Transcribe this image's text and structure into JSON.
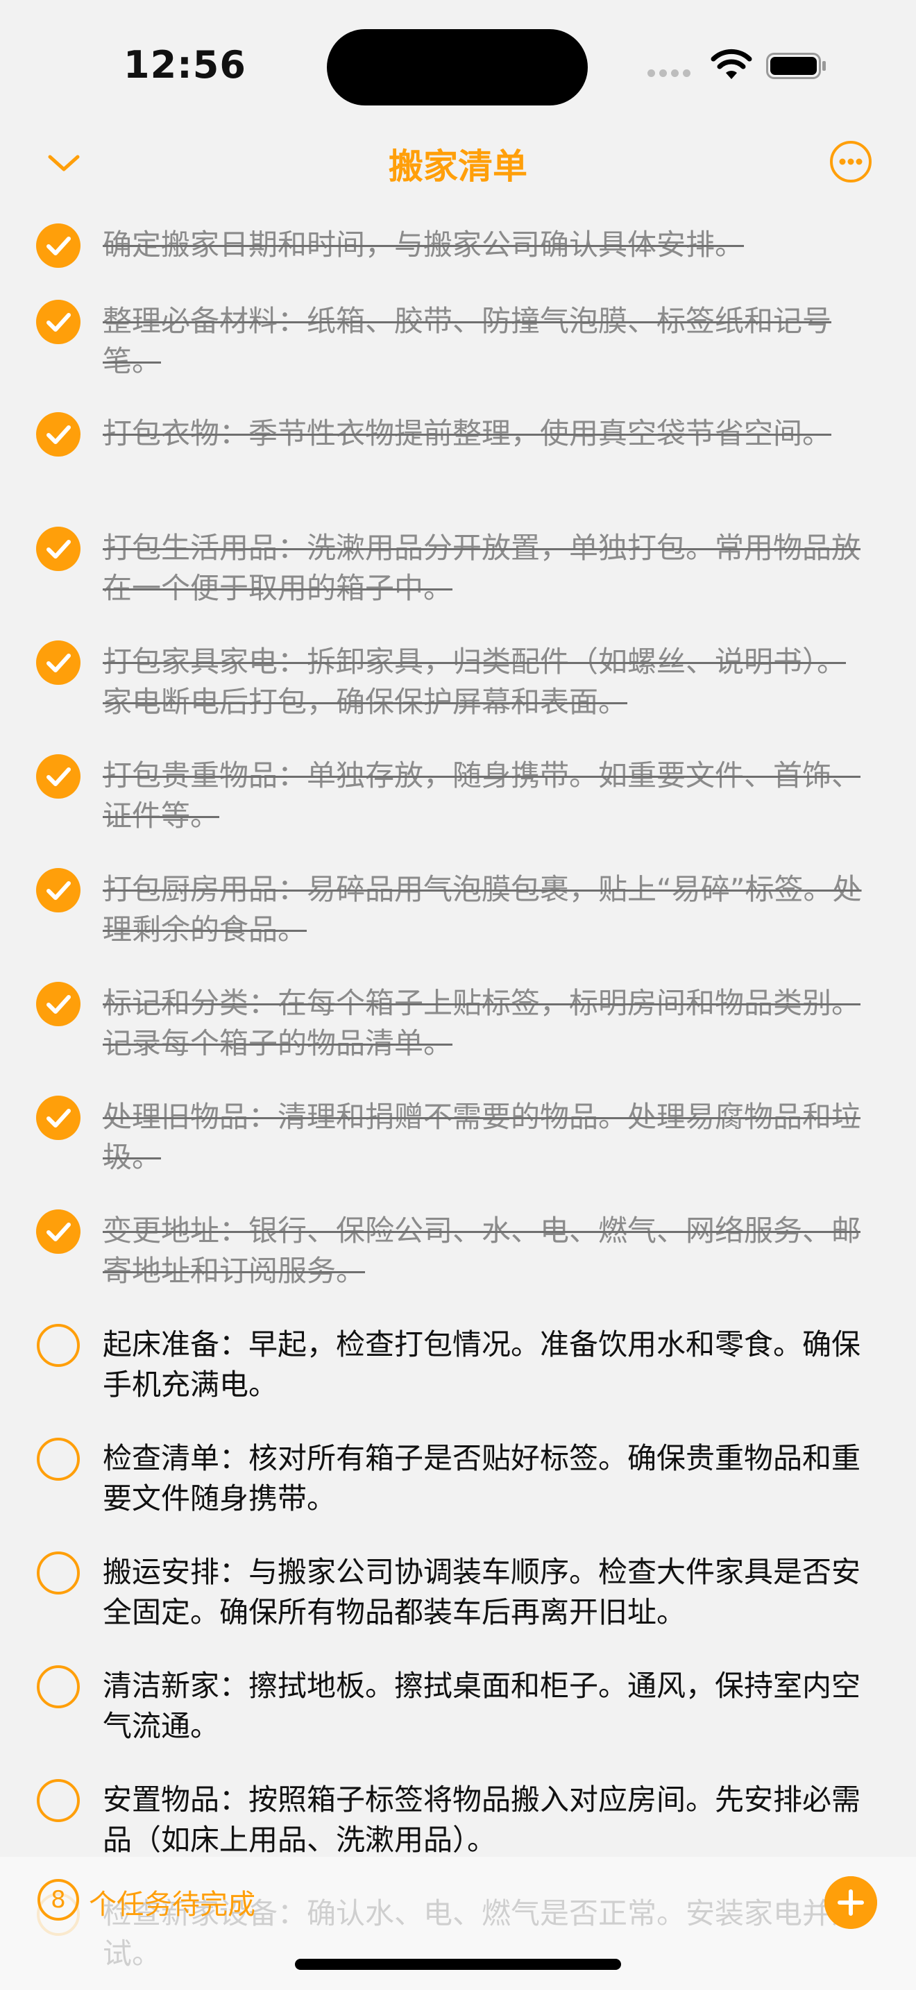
{
  "status_bar": {
    "time": "12:56"
  },
  "nav": {
    "title": "搬家清单"
  },
  "tasks": [
    {
      "text": "确定搬家日期和时间，与搬家公司确认具体安排。",
      "done": true
    },
    {
      "text": "整理必备材料：纸箱、胶带、防撞气泡膜、标签纸和记号笔。",
      "done": true
    },
    {
      "text": "打包衣物：季节性衣物提前整理，使用真空袋节省空间。",
      "done": true
    },
    {
      "text": "打包生活用品：洗漱用品分开放置，单独打包。常用物品放在一个便于取用的箱子中。",
      "done": true
    },
    {
      "text": "打包家具家电：拆卸家具，归类配件（如螺丝、说明书）。家电断电后打包，确保保护屏幕和表面。",
      "done": true
    },
    {
      "text": "打包贵重物品：单独存放，随身携带。如重要文件、首饰、证件等。",
      "done": true
    },
    {
      "text": "打包厨房用品：易碎品用气泡膜包裹，贴上“易碎”标签。处理剩余的食品。",
      "done": true
    },
    {
      "text": "标记和分类：在每个箱子上贴标签，标明房间和物品类别。记录每个箱子的物品清单。",
      "done": true
    },
    {
      "text": "处理旧物品：清理和捐赠不需要的物品。处理易腐物品和垃圾。",
      "done": true
    },
    {
      "text": "变更地址：银行、保险公司、水、电、燃气、网络服务、邮寄地址和订阅服务。",
      "done": true
    },
    {
      "text": "起床准备：早起，检查打包情况。准备饮用水和零食。确保手机充满电。",
      "done": false
    },
    {
      "text": "检查清单：核对所有箱子是否贴好标签。确保贵重物品和重要文件随身携带。",
      "done": false
    },
    {
      "text": "搬运安排：与搬家公司协调装车顺序。检查大件家具是否安全固定。确保所有物品都装车后再离开旧址。",
      "done": false
    },
    {
      "text": "清洁新家：擦拭地板。擦拭桌面和柜子。通风，保持室内空气流通。",
      "done": false
    },
    {
      "text": "安置物品：按照箱子标签将物品搬入对应房间。先安排必需品（如床上用品、洗漱用品）。",
      "done": false
    },
    {
      "text": "检查新家设备：确认水、电、燃气是否正常。安装家电并测试。",
      "done": false
    }
  ],
  "footer": {
    "count": "8",
    "count_label": "个任务待完成"
  },
  "colors": {
    "accent": "#ff9f0a",
    "done_text": "#8b8b8b",
    "background": "#f2f2f2"
  }
}
